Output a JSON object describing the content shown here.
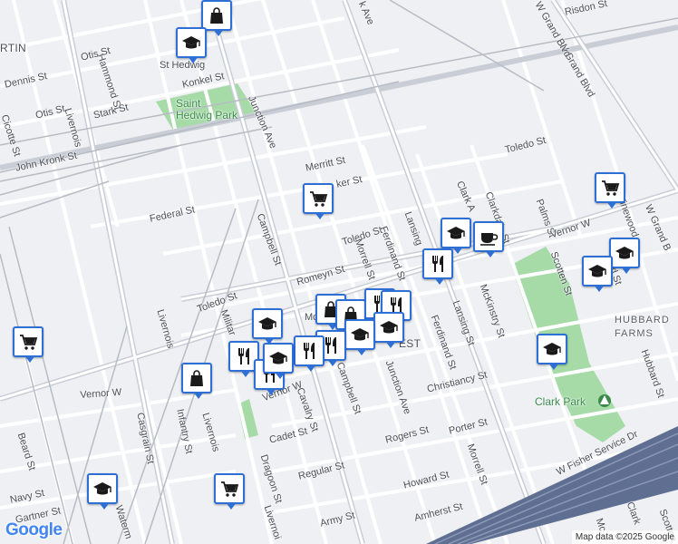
{
  "map": {
    "attribution": "Map data ©2025 Google",
    "logo": "Google",
    "colors": {
      "background": "#eef0f3",
      "road": "#ffffff",
      "major_road": "#c9ced6",
      "park": "#a6dba8",
      "freeway": "#5e6f91",
      "pin_border": "#2e6fd6",
      "icon": "#1a1a1a"
    },
    "labels": [
      {
        "id": "martin",
        "text": "RTIN"
      },
      {
        "id": "dennis",
        "text": "Dennis St"
      },
      {
        "id": "hammond",
        "text": "Hammond St"
      },
      {
        "id": "otis1",
        "text": "Otis St"
      },
      {
        "id": "otis2",
        "text": "Otis St"
      },
      {
        "id": "stark",
        "text": "Stark St"
      },
      {
        "id": "cicotte",
        "text": "Cicotte St"
      },
      {
        "id": "livernois_n",
        "text": "Livernois"
      },
      {
        "id": "sthedwig",
        "text": "St Hedwig"
      },
      {
        "id": "konkel",
        "text": "Konkel St"
      },
      {
        "id": "hedwigpark",
        "text": "Saint Hedwig Park"
      },
      {
        "id": "junction_n",
        "text": "Junction Ave"
      },
      {
        "id": "kronk",
        "text": "John Kronk St"
      },
      {
        "id": "kave",
        "text": "k Ave"
      },
      {
        "id": "risdon",
        "text": "Risdon St"
      },
      {
        "id": "wgrand",
        "text": "W Grand Blvd"
      },
      {
        "id": "wgrand2",
        "text": "W Grand Blvd"
      },
      {
        "id": "toledo_e",
        "text": "Toledo St"
      },
      {
        "id": "merritt",
        "text": "Merritt St"
      },
      {
        "id": "parker",
        "text": "ker St"
      },
      {
        "id": "federal",
        "text": "Federal St"
      },
      {
        "id": "campbell_n",
        "text": "Campbell St"
      },
      {
        "id": "toledo_m",
        "text": "Toledo St"
      },
      {
        "id": "lansing_n",
        "text": "Lansing"
      },
      {
        "id": "ferdinand_n",
        "text": "Ferdinand St"
      },
      {
        "id": "morrell_n",
        "text": "Morrell St"
      },
      {
        "id": "clarkdale",
        "text": "Clarkdale St"
      },
      {
        "id": "clarkave",
        "text": "Clark A"
      },
      {
        "id": "palms",
        "text": "Palms St"
      },
      {
        "id": "vernor_e",
        "text": "Vernor W"
      },
      {
        "id": "vinewood",
        "text": "Vinewood"
      },
      {
        "id": "grandb",
        "text": "W Grand B"
      },
      {
        "id": "scotten",
        "text": "Scotten St"
      },
      {
        "id": "rdst",
        "text": "rd St"
      },
      {
        "id": "romeyn",
        "text": "Romeyn St"
      },
      {
        "id": "toledo_w",
        "text": "Toledo St"
      },
      {
        "id": "military",
        "text": "Militar"
      },
      {
        "id": "mc",
        "text": "Mc"
      },
      {
        "id": "est",
        "text": "EST"
      },
      {
        "id": "mckinstry",
        "text": "McKinstry St"
      },
      {
        "id": "lansing_s",
        "text": "Lansing St"
      },
      {
        "id": "ferdinand_s",
        "text": "Ferdinand St"
      },
      {
        "id": "hubbard_farms",
        "text": "HUBBARD FARMS"
      },
      {
        "id": "hubbard_st",
        "text": "Hubbard St"
      },
      {
        "id": "livernois_m",
        "text": "Livernois"
      },
      {
        "id": "vernor_w",
        "text": "Vernor W"
      },
      {
        "id": "vernor_w2",
        "text": "Vernor W"
      },
      {
        "id": "campbell_s",
        "text": "Campbell St"
      },
      {
        "id": "junction_s",
        "text": "Junction Ave"
      },
      {
        "id": "christiancy",
        "text": "Christiancy St"
      },
      {
        "id": "clarkpark",
        "text": "Clark Park"
      },
      {
        "id": "cavalry",
        "text": "Cavalry St"
      },
      {
        "id": "casgrain",
        "text": "Casgrain St"
      },
      {
        "id": "infantry",
        "text": "Infantry St"
      },
      {
        "id": "livernois_s",
        "text": "Livernois"
      },
      {
        "id": "cadet",
        "text": "Cadet St"
      },
      {
        "id": "rogers",
        "text": "Rogers St"
      },
      {
        "id": "porter",
        "text": "Porter St"
      },
      {
        "id": "fisher",
        "text": "W Fisher Service Dr"
      },
      {
        "id": "beard",
        "text": "Beard St"
      },
      {
        "id": "dragoon",
        "text": "Dragoon St"
      },
      {
        "id": "regular",
        "text": "Regular St"
      },
      {
        "id": "morrell_s",
        "text": "Morrell St"
      },
      {
        "id": "howard",
        "text": "Howard St"
      },
      {
        "id": "navy",
        "text": "Navy St"
      },
      {
        "id": "gartner",
        "text": "Gartner St"
      },
      {
        "id": "waterman",
        "text": "Waterm"
      },
      {
        "id": "livernois_b",
        "text": "Livernoi"
      },
      {
        "id": "army",
        "text": "Army St"
      },
      {
        "id": "amherst",
        "text": "Amherst St"
      },
      {
        "id": "clark_b",
        "text": "Clark"
      },
      {
        "id": "mc_b",
        "text": "Mc"
      },
      {
        "id": "scotten_b",
        "text": "Scotten St"
      }
    ],
    "pins": [
      {
        "id": "p1",
        "icon": "shopping-bag"
      },
      {
        "id": "p2",
        "icon": "school"
      },
      {
        "id": "p3",
        "icon": "shopping-cart"
      },
      {
        "id": "p4",
        "icon": "school"
      },
      {
        "id": "p5",
        "icon": "coffee"
      },
      {
        "id": "p6",
        "icon": "restaurant"
      },
      {
        "id": "p7",
        "icon": "shopping-cart"
      },
      {
        "id": "p8",
        "icon": "school"
      },
      {
        "id": "p9",
        "icon": "school"
      },
      {
        "id": "p10",
        "icon": "shopping-cart"
      },
      {
        "id": "p11",
        "icon": "school"
      },
      {
        "id": "p12",
        "icon": "school"
      },
      {
        "id": "p13",
        "icon": "shopping-bag"
      },
      {
        "id": "p14",
        "icon": "shopping-bag"
      },
      {
        "id": "p15",
        "icon": "restaurant"
      },
      {
        "id": "p16",
        "icon": "restaurant"
      },
      {
        "id": "p17",
        "icon": "school"
      },
      {
        "id": "p18",
        "icon": "school"
      },
      {
        "id": "p19",
        "icon": "restaurant"
      },
      {
        "id": "p20",
        "icon": "restaurant"
      },
      {
        "id": "p21",
        "icon": "restaurant"
      },
      {
        "id": "p22",
        "icon": "restaurant"
      },
      {
        "id": "p23",
        "icon": "shopping-bag"
      },
      {
        "id": "p24",
        "icon": "school"
      },
      {
        "id": "p25",
        "icon": "shopping-cart"
      },
      {
        "id": "p26",
        "icon": "school"
      }
    ]
  }
}
